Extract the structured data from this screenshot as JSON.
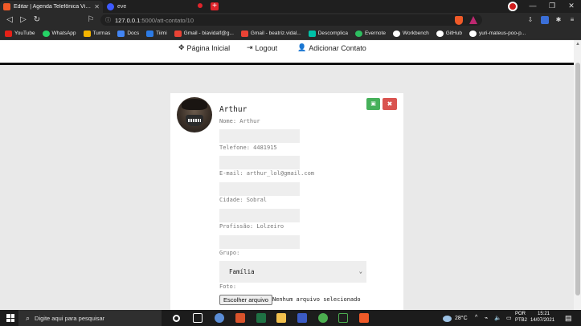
{
  "browser": {
    "tabs": [
      {
        "title": "Editar | Agenda Telefônica Virtual",
        "active": true
      },
      {
        "title": "eve",
        "active": false
      }
    ],
    "url_host": "127.0.0.1",
    "url_path": ":5000/att-contato/10",
    "bookmarks": [
      "YouTube",
      "WhatsApp",
      "Turmas",
      "Docs",
      "Tiimi",
      "Gmail - biavidalf@g...",
      "Gmail - beatriz.vidal...",
      "Descomplica",
      "Evernote",
      "Workbench",
      "GitHub",
      "yuri-mateus-poo-p..."
    ]
  },
  "nav": {
    "home": "Página Inicial",
    "logout": "Logout",
    "add_contact": "Adicionar Contato"
  },
  "contact": {
    "name": "Arthur",
    "name_label": "Nome: Arthur",
    "phone_label": "Telefone: 4481915",
    "email_label": "E-mail: arthur_lol@gmail.com",
    "city_label": "Cidade: Sobral",
    "profession_label": "Profissão: Lolzeiro",
    "group_label": "Grupo:",
    "group_value": "Família",
    "photo_label": "Foto:",
    "file_button": "Escolher arquivo",
    "file_status": "Nenhum arquivo selecionado"
  },
  "taskbar": {
    "search_placeholder": "Digite aqui para pesquisar",
    "temperature": "28°C",
    "lang": "POR",
    "layout": "PTB2",
    "time": "15:21",
    "date": "14/07/2021"
  },
  "colors": {
    "save": "#46b05a",
    "cancel": "#d9534f",
    "brave": "#f05a28"
  }
}
